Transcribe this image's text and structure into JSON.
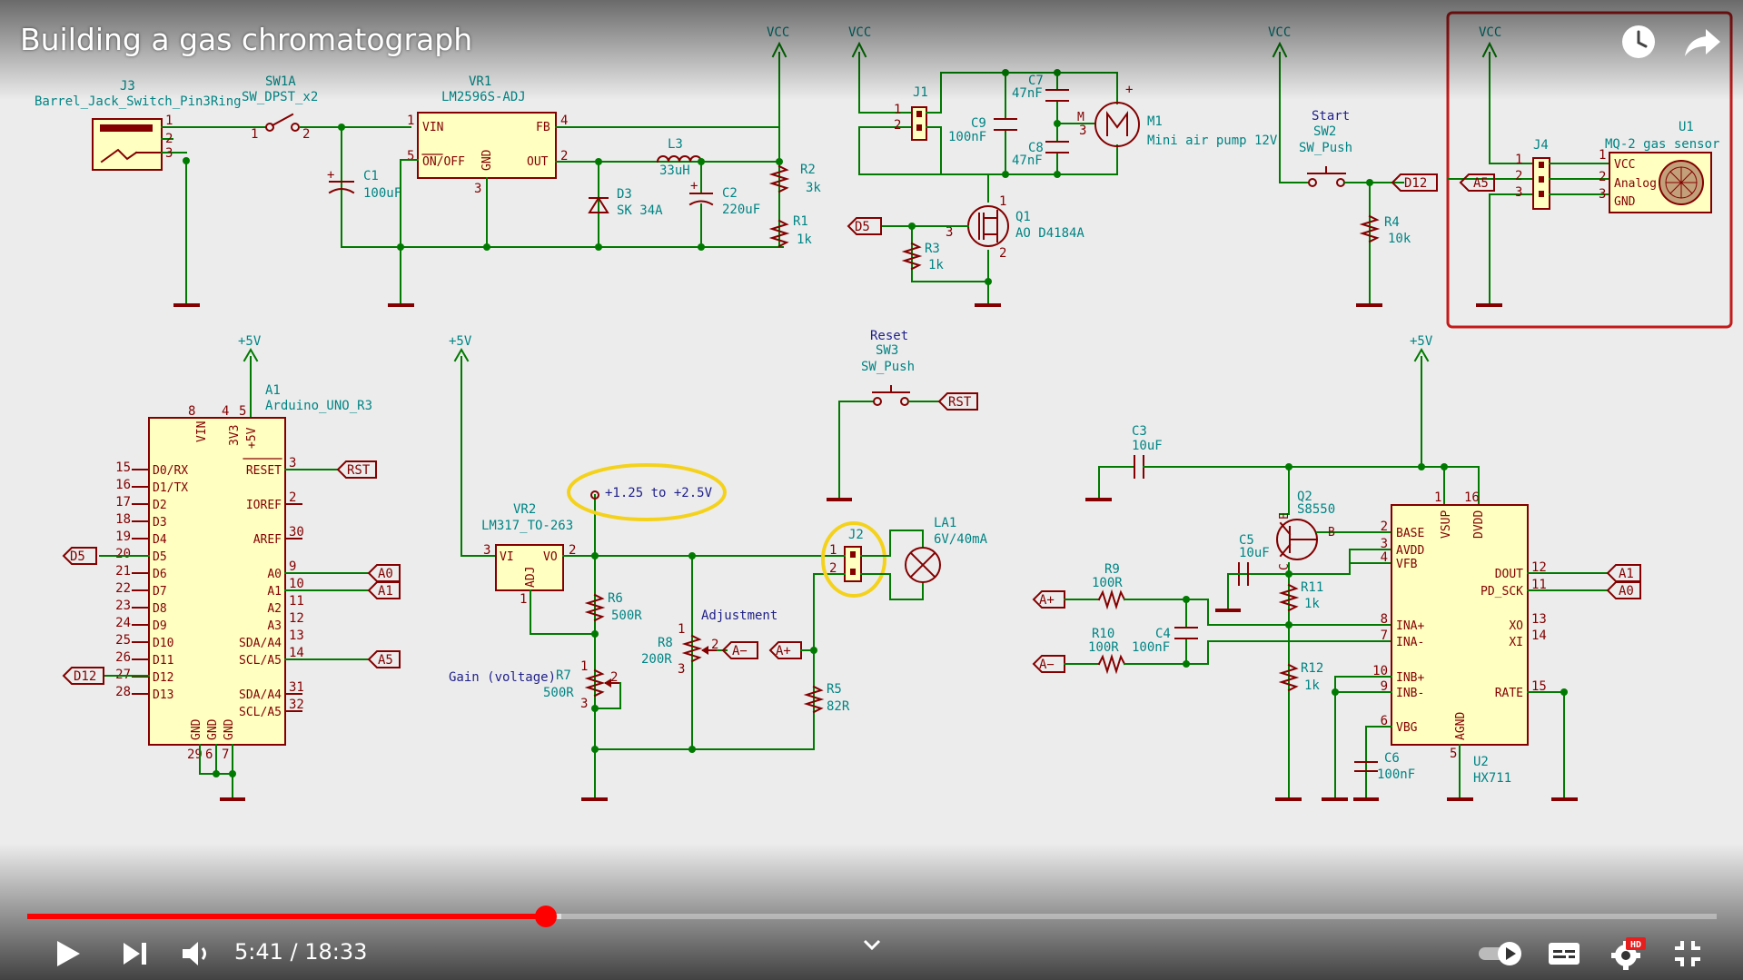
{
  "video": {
    "title": "Building a gas chromatograph",
    "current_time": "5:41",
    "separator": " / ",
    "duration": "18:33",
    "progress_fraction": 0.307,
    "buffered_fraction": 0.316,
    "hd_badge": "HD",
    "icons": [
      "watch-later-icon",
      "share-icon",
      "play-icon",
      "next-icon",
      "volume-icon",
      "autoplay-toggle-icon",
      "captions-icon",
      "settings-icon",
      "exit-fullscreen-icon",
      "chevron-down-icon"
    ]
  },
  "colors": {
    "wire": "#007a00",
    "outline": "#840000",
    "body": "#ffffc2",
    "label": "#008484",
    "pin": "#840000",
    "highlight": "#f4d21c",
    "accent_box": "#c41a1a",
    "progress": "#ff0000",
    "text": "#222222",
    "net": "#0000c4"
  },
  "schematic": {
    "top": {
      "j3_ref": "J3",
      "j3_val": "Barrel_Jack_Switch_Pin3Ring",
      "sw1_ref": "SW1A",
      "sw1_val": "SW_DPST_x2",
      "vr1_ref": "VR1",
      "vr1_val": "LM2596S-ADJ",
      "vr1_vin": "VIN",
      "vr1_fb": "FB",
      "vr1_onoff": "ON/OFF",
      "vr1_gnd": "GND",
      "vr1_out": "OUT",
      "c1_ref": "C1",
      "c1_val": "100uF",
      "l3_ref": "L3",
      "l3_val": "33uH",
      "d3_ref": "D3",
      "d3_val": "SK 34A",
      "c2_ref": "C2",
      "c2_val": "220uF",
      "r2_ref": "R2",
      "r2_val": "3k",
      "r1_ref": "R1",
      "r1_val": "1k",
      "vcc": "VCC",
      "j1_ref": "J1",
      "c7_ref": "C7",
      "c7_val": "47nF",
      "c9_ref": "C9",
      "c9_val": "100nF",
      "c8_ref": "C8",
      "c8_val": "47nF",
      "m1_ref": "M1",
      "m1_val": "Mini air pump 12V",
      "m_letter": "M",
      "q1_ref": "Q1",
      "q1_val": "AO D4184A",
      "r3_ref": "R3",
      "r3_val": "1k",
      "sw2_title": "Start",
      "sw2_ref": "SW2",
      "sw2_val": "SW_Push",
      "r4_ref": "R4",
      "r4_val": "10k",
      "j4_ref": "J4",
      "u1_ref": "U1",
      "u1_val": "MQ-2 gas sensor",
      "u1_vcc": "VCC",
      "u1_analog": "Analog",
      "u1_gnd": "GND"
    },
    "bottom": {
      "a1_ref": "A1",
      "a1_val": "Arduino_UNO_R3",
      "a1_vin": "VIN",
      "a1_3v3": "3V3",
      "a1_5v": "+5V",
      "a1_left": [
        "D0/RX",
        "D1/TX",
        "D2",
        "D3",
        "D4",
        "D5",
        "D6",
        "D7",
        "D8",
        "D9",
        "D10",
        "D11",
        "D12",
        "D13"
      ],
      "a1_left_pins": [
        "15",
        "16",
        "17",
        "18",
        "19",
        "20",
        "21",
        "22",
        "23",
        "24",
        "25",
        "26",
        "27",
        "28"
      ],
      "a1_right_top": [
        "RESET",
        "IOREF",
        "AREF"
      ],
      "a1_right_top_pins": [
        "3",
        "2",
        "30"
      ],
      "a1_right": [
        "A0",
        "A1",
        "A2",
        "A3",
        "SDA/A4",
        "SCL/A5"
      ],
      "a1_right_pins": [
        "9",
        "10",
        "11",
        "12",
        "13",
        "14"
      ],
      "a1_right_bot": [
        "SDA/A4",
        "SCL/A5"
      ],
      "a1_right_bot_pins": [
        "31",
        "32"
      ],
      "a1_gnd": "GND",
      "a1_top_pins": [
        "8",
        "4",
        "5"
      ],
      "a1_bottom_pins": [
        "29",
        "6",
        "7"
      ],
      "plus5v": "+5V",
      "vr2_ref": "VR2",
      "vr2_val": "LM317_TO-263",
      "vr2_vi": "VI",
      "vr2_vo": "VO",
      "vr2_adj": "ADJ",
      "v_range": "+1.25 to +2.5V",
      "r6_ref": "R6",
      "r6_val": "500R",
      "r7_ref": "R7",
      "r7_val": "500R",
      "gain_label": "Gain (voltage)",
      "r8_ref": "R8",
      "r8_val": "200R",
      "adjust_label": "Adjustment",
      "r5_ref": "R5",
      "r5_val": "82R",
      "sw3_title": "Reset",
      "sw3_ref": "SW3",
      "sw3_val": "SW_Push",
      "j2_ref": "J2",
      "la1_ref": "LA1",
      "la1_val": "6V/40mA",
      "c3_ref": "C3",
      "c3_val": "10uF",
      "q2_ref": "Q2",
      "q2_val": "S8550",
      "q2_b": "B",
      "q2_e": "E",
      "q2_c": "C",
      "c5_ref": "C5",
      "c5_val": "10uF",
      "r9_ref": "R9",
      "r9_val": "100R",
      "r10_ref": "R10",
      "r10_val": "100R",
      "c4_ref": "C4",
      "c4_val": "100nF",
      "r11_ref": "R11",
      "r11_val": "1k",
      "r12_ref": "R12",
      "r12_val": "1k",
      "c6_ref": "C6",
      "c6_val": "100nF",
      "u2_ref": "U2",
      "u2_val": "HX711",
      "u2_left": [
        "BASE",
        "AVDD",
        "VFB",
        "INA+",
        "INA-",
        "INB+",
        "INB-",
        "VBG"
      ],
      "u2_left_pins": [
        "2",
        "3",
        "4",
        "8",
        "7",
        "10",
        "9",
        "6"
      ],
      "u2_right": [
        "DOUT",
        "PD_SCK",
        "XO",
        "XI",
        "RATE"
      ],
      "u2_right_pins": [
        "12",
        "11",
        "13",
        "14",
        "15"
      ],
      "u2_vsup": "VSUP",
      "u2_dvdd": "DVDD",
      "u2_agnd": "AGND",
      "u2_top_pins": [
        "1",
        "16"
      ],
      "u2_bottom_pin": "5"
    },
    "net_labels": {
      "d5": "D5",
      "d12": "D12",
      "a5": "A5",
      "a0": "A0",
      "a1": "A1",
      "rst": "RST",
      "a_minus": "A−",
      "a_plus": "A+"
    },
    "pins": {
      "p1": "1",
      "p2": "2",
      "p3": "3",
      "p4": "4",
      "p5": "5"
    }
  }
}
